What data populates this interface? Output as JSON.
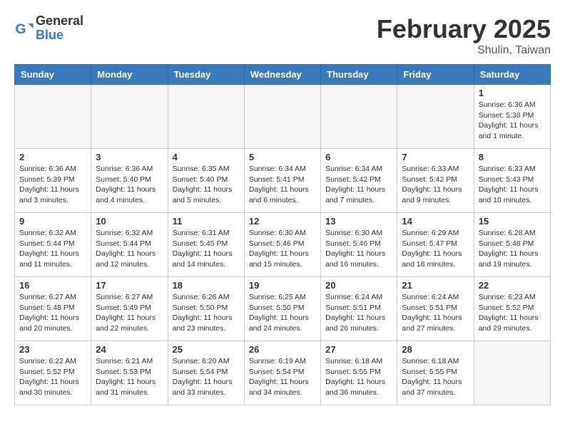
{
  "header": {
    "logo_text_general": "General",
    "logo_text_blue": "Blue",
    "month_title": "February 2025",
    "location": "Shulin, Taiwan"
  },
  "weekdays": [
    "Sunday",
    "Monday",
    "Tuesday",
    "Wednesday",
    "Thursday",
    "Friday",
    "Saturday"
  ],
  "weeks": [
    [
      {
        "day": "",
        "info": "",
        "empty": true
      },
      {
        "day": "",
        "info": "",
        "empty": true
      },
      {
        "day": "",
        "info": "",
        "empty": true
      },
      {
        "day": "",
        "info": "",
        "empty": true
      },
      {
        "day": "",
        "info": "",
        "empty": true
      },
      {
        "day": "",
        "info": "",
        "empty": true
      },
      {
        "day": "1",
        "info": "Sunrise: 6:36 AM\nSunset: 5:38 PM\nDaylight: 11 hours and 1 minute."
      }
    ],
    [
      {
        "day": "2",
        "info": "Sunrise: 6:36 AM\nSunset: 5:39 PM\nDaylight: 11 hours and 3 minutes."
      },
      {
        "day": "3",
        "info": "Sunrise: 6:36 AM\nSunset: 5:40 PM\nDaylight: 11 hours and 4 minutes."
      },
      {
        "day": "4",
        "info": "Sunrise: 6:35 AM\nSunset: 5:40 PM\nDaylight: 11 hours and 5 minutes."
      },
      {
        "day": "5",
        "info": "Sunrise: 6:34 AM\nSunset: 5:41 PM\nDaylight: 11 hours and 6 minutes."
      },
      {
        "day": "6",
        "info": "Sunrise: 6:34 AM\nSunset: 5:42 PM\nDaylight: 11 hours and 7 minutes."
      },
      {
        "day": "7",
        "info": "Sunrise: 6:33 AM\nSunset: 5:42 PM\nDaylight: 11 hours and 9 minutes."
      },
      {
        "day": "8",
        "info": "Sunrise: 6:33 AM\nSunset: 5:43 PM\nDaylight: 11 hours and 10 minutes."
      }
    ],
    [
      {
        "day": "9",
        "info": "Sunrise: 6:32 AM\nSunset: 5:44 PM\nDaylight: 11 hours and 11 minutes."
      },
      {
        "day": "10",
        "info": "Sunrise: 6:32 AM\nSunset: 5:44 PM\nDaylight: 11 hours and 12 minutes."
      },
      {
        "day": "11",
        "info": "Sunrise: 6:31 AM\nSunset: 5:45 PM\nDaylight: 11 hours and 14 minutes."
      },
      {
        "day": "12",
        "info": "Sunrise: 6:30 AM\nSunset: 5:46 PM\nDaylight: 11 hours and 15 minutes."
      },
      {
        "day": "13",
        "info": "Sunrise: 6:30 AM\nSunset: 5:46 PM\nDaylight: 11 hours and 16 minutes."
      },
      {
        "day": "14",
        "info": "Sunrise: 6:29 AM\nSunset: 5:47 PM\nDaylight: 11 hours and 18 minutes."
      },
      {
        "day": "15",
        "info": "Sunrise: 6:28 AM\nSunset: 5:48 PM\nDaylight: 11 hours and 19 minutes."
      }
    ],
    [
      {
        "day": "16",
        "info": "Sunrise: 6:27 AM\nSunset: 5:48 PM\nDaylight: 11 hours and 20 minutes."
      },
      {
        "day": "17",
        "info": "Sunrise: 6:27 AM\nSunset: 5:49 PM\nDaylight: 11 hours and 22 minutes."
      },
      {
        "day": "18",
        "info": "Sunrise: 6:26 AM\nSunset: 5:50 PM\nDaylight: 11 hours and 23 minutes."
      },
      {
        "day": "19",
        "info": "Sunrise: 6:25 AM\nSunset: 5:50 PM\nDaylight: 11 hours and 24 minutes."
      },
      {
        "day": "20",
        "info": "Sunrise: 6:24 AM\nSunset: 5:51 PM\nDaylight: 11 hours and 26 minutes."
      },
      {
        "day": "21",
        "info": "Sunrise: 6:24 AM\nSunset: 5:51 PM\nDaylight: 11 hours and 27 minutes."
      },
      {
        "day": "22",
        "info": "Sunrise: 6:23 AM\nSunset: 5:52 PM\nDaylight: 11 hours and 29 minutes."
      }
    ],
    [
      {
        "day": "23",
        "info": "Sunrise: 6:22 AM\nSunset: 5:52 PM\nDaylight: 11 hours and 30 minutes."
      },
      {
        "day": "24",
        "info": "Sunrise: 6:21 AM\nSunset: 5:53 PM\nDaylight: 11 hours and 31 minutes."
      },
      {
        "day": "25",
        "info": "Sunrise: 6:20 AM\nSunset: 5:54 PM\nDaylight: 11 hours and 33 minutes."
      },
      {
        "day": "26",
        "info": "Sunrise: 6:19 AM\nSunset: 5:54 PM\nDaylight: 11 hours and 34 minutes."
      },
      {
        "day": "27",
        "info": "Sunrise: 6:18 AM\nSunset: 5:55 PM\nDaylight: 11 hours and 36 minutes."
      },
      {
        "day": "28",
        "info": "Sunrise: 6:18 AM\nSunset: 5:55 PM\nDaylight: 11 hours and 37 minutes."
      },
      {
        "day": "",
        "info": "",
        "empty": true
      }
    ]
  ]
}
